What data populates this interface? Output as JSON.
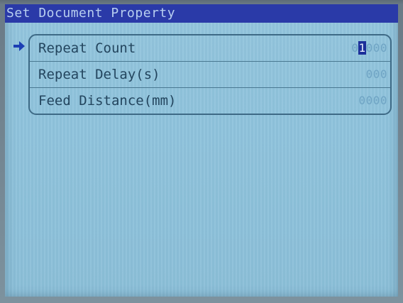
{
  "header": {
    "title": "Set Document Property"
  },
  "menu": {
    "selected_index": 0,
    "items": [
      {
        "label": "Repeat Count",
        "value_before_cursor": "0",
        "value_cursor": "1",
        "value_after_cursor": "000"
      },
      {
        "label": "Repeat Delay(s)",
        "value": "000"
      },
      {
        "label": "Feed Distance(mm)",
        "value": "0000"
      }
    ]
  },
  "colors": {
    "title_bar": "#2a3aa8",
    "screen_background": "#8fc3dc",
    "label_text": "#23455e",
    "value_text": "#6fa4c4",
    "selection_arrow": "#1c3fb4",
    "cursor_highlight": "#1c2f9a"
  },
  "icons": {
    "selection_pointer": "right-arrow-icon"
  }
}
